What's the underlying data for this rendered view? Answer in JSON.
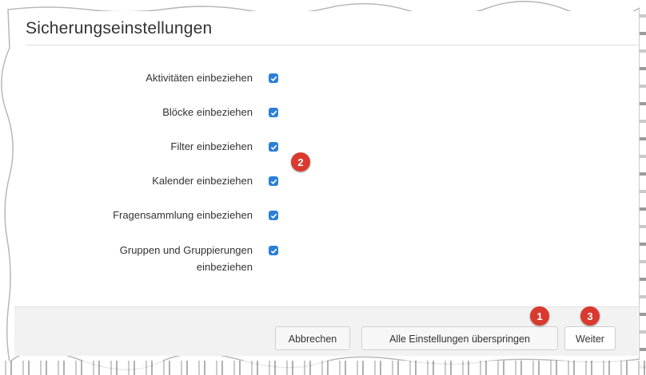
{
  "dialog": {
    "title": "Sicherungseinstellungen"
  },
  "settings": [
    {
      "label": "Aktivitäten einbeziehen",
      "checked": true
    },
    {
      "label": "Blöcke einbeziehen",
      "checked": true
    },
    {
      "label": "Filter einbeziehen",
      "checked": true
    },
    {
      "label": "Kalender einbeziehen",
      "checked": true
    },
    {
      "label": "Fragensammlung einbeziehen",
      "checked": true
    },
    {
      "label_line1": "Gruppen und Gruppierungen",
      "label_line2": "einbeziehen",
      "checked": true
    }
  ],
  "buttons": {
    "cancel": "Abbrechen",
    "skip_all": "Alle Einstellungen überspringen",
    "next": "Weiter"
  },
  "badges": {
    "one": "1",
    "two": "2",
    "three": "3"
  },
  "colors": {
    "checkbox": "#2b7fd6",
    "badge": "#d9392f",
    "footer_bg": "#f2f2f2"
  }
}
